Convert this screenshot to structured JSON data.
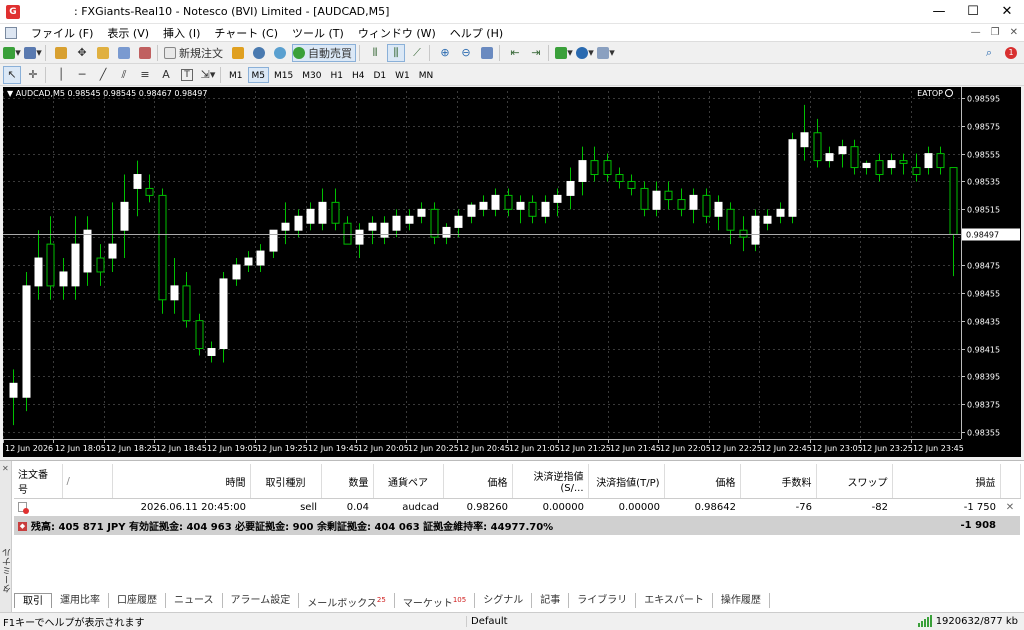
{
  "window": {
    "title": ": FXGiants-Real10 - Notesco (BVI) Limited - [AUDCAD,M5]",
    "app_icon": "G",
    "minimize": "—",
    "maximize": "☐",
    "close": "✕"
  },
  "menu": [
    "ファイル (F)",
    "表示 (V)",
    "挿入 (I)",
    "チャート (C)",
    "ツール (T)",
    "ウィンドウ (W)",
    "ヘルプ (H)"
  ],
  "toolbar": {
    "new_order": "新規注文",
    "auto_trading": "自動売買",
    "timeframes": [
      "M1",
      "M5",
      "M15",
      "M30",
      "H1",
      "H4",
      "D1",
      "W1",
      "MN"
    ],
    "selected_timeframe": "M5",
    "text_tool": "A",
    "text_label_tool": "T"
  },
  "chart": {
    "header": "AUDCAD,M5  0.98545 0.98545 0.98467 0.98497",
    "ea_label": "EATOP",
    "current_price": "0.98497",
    "colors": {
      "background": "#000000",
      "grid": "#3a3a3a",
      "bull_body": "#ffffff",
      "wick": "#00c000",
      "text": "#ffffff"
    },
    "price_labels": [
      "0.98595",
      "0.98575",
      "0.98555",
      "0.98535",
      "0.98515",
      "0.98495",
      "0.98475",
      "0.98455",
      "0.98435",
      "0.98415",
      "0.98395",
      "0.98375",
      "0.98355"
    ],
    "time_labels": [
      "12 Jun 2026",
      "12 Jun 18:05",
      "12 Jun 18:25",
      "12 Jun 18:45",
      "12 Jun 19:05",
      "12 Jun 19:25",
      "12 Jun 19:45",
      "12 Jun 20:05",
      "12 Jun 20:25",
      "12 Jun 20:45",
      "12 Jun 21:05",
      "12 Jun 21:25",
      "12 Jun 21:45",
      "12 Jun 22:05",
      "12 Jun 22:25",
      "12 Jun 22:45",
      "12 Jun 23:05",
      "12 Jun 23:25",
      "12 Jun 23:45"
    ]
  },
  "chart_data": {
    "type": "candlestick",
    "symbol": "AUDCAD",
    "timeframe": "M5",
    "ylim": [
      0.9835,
      0.986
    ],
    "candles": [
      {
        "o": 0.9838,
        "h": 0.984,
        "l": 0.9836,
        "c": 0.9839
      },
      {
        "o": 0.9838,
        "h": 0.9847,
        "l": 0.9837,
        "c": 0.9846
      },
      {
        "o": 0.9846,
        "h": 0.985,
        "l": 0.9845,
        "c": 0.9848
      },
      {
        "o": 0.9849,
        "h": 0.9851,
        "l": 0.9845,
        "c": 0.9846
      },
      {
        "o": 0.9846,
        "h": 0.9848,
        "l": 0.9845,
        "c": 0.9847
      },
      {
        "o": 0.9846,
        "h": 0.9851,
        "l": 0.9845,
        "c": 0.9849
      },
      {
        "o": 0.9847,
        "h": 0.9851,
        "l": 0.9846,
        "c": 0.985
      },
      {
        "o": 0.9848,
        "h": 0.9849,
        "l": 0.9846,
        "c": 0.9847
      },
      {
        "o": 0.9848,
        "h": 0.9852,
        "l": 0.9847,
        "c": 0.9849
      },
      {
        "o": 0.985,
        "h": 0.9854,
        "l": 0.9848,
        "c": 0.9852
      },
      {
        "o": 0.9853,
        "h": 0.9855,
        "l": 0.9851,
        "c": 0.9854
      },
      {
        "o": 0.9853,
        "h": 0.9854,
        "l": 0.9852,
        "c": 0.98525
      },
      {
        "o": 0.98525,
        "h": 0.9853,
        "l": 0.9844,
        "c": 0.9845
      },
      {
        "o": 0.9845,
        "h": 0.9848,
        "l": 0.9844,
        "c": 0.9846
      },
      {
        "o": 0.9846,
        "h": 0.9847,
        "l": 0.9843,
        "c": 0.98435
      },
      {
        "o": 0.98435,
        "h": 0.9844,
        "l": 0.9841,
        "c": 0.98415
      },
      {
        "o": 0.9841,
        "h": 0.9842,
        "l": 0.98405,
        "c": 0.98415
      },
      {
        "o": 0.98415,
        "h": 0.9847,
        "l": 0.98405,
        "c": 0.98465
      },
      {
        "o": 0.98465,
        "h": 0.9848,
        "l": 0.9846,
        "c": 0.98475
      },
      {
        "o": 0.98475,
        "h": 0.98485,
        "l": 0.9847,
        "c": 0.9848
      },
      {
        "o": 0.98475,
        "h": 0.9849,
        "l": 0.9847,
        "c": 0.98485
      },
      {
        "o": 0.98485,
        "h": 0.985,
        "l": 0.9848,
        "c": 0.985
      },
      {
        "o": 0.985,
        "h": 0.9852,
        "l": 0.9849,
        "c": 0.98505
      },
      {
        "o": 0.985,
        "h": 0.98515,
        "l": 0.98495,
        "c": 0.9851
      },
      {
        "o": 0.98505,
        "h": 0.9852,
        "l": 0.985,
        "c": 0.98515
      },
      {
        "o": 0.98505,
        "h": 0.9853,
        "l": 0.985,
        "c": 0.9852
      },
      {
        "o": 0.9852,
        "h": 0.9853,
        "l": 0.985,
        "c": 0.98505
      },
      {
        "o": 0.98505,
        "h": 0.9851,
        "l": 0.9849,
        "c": 0.9849
      },
      {
        "o": 0.9849,
        "h": 0.98505,
        "l": 0.9848,
        "c": 0.985
      },
      {
        "o": 0.985,
        "h": 0.9851,
        "l": 0.9849,
        "c": 0.98505
      },
      {
        "o": 0.98495,
        "h": 0.9851,
        "l": 0.9849,
        "c": 0.98505
      },
      {
        "o": 0.985,
        "h": 0.98515,
        "l": 0.98495,
        "c": 0.9851
      },
      {
        "o": 0.98505,
        "h": 0.98515,
        "l": 0.985,
        "c": 0.9851
      },
      {
        "o": 0.9851,
        "h": 0.9852,
        "l": 0.98505,
        "c": 0.98515
      },
      {
        "o": 0.98515,
        "h": 0.9852,
        "l": 0.9849,
        "c": 0.98495
      },
      {
        "o": 0.98495,
        "h": 0.98505,
        "l": 0.9849,
        "c": 0.98502
      },
      {
        "o": 0.98502,
        "h": 0.98515,
        "l": 0.98495,
        "c": 0.9851
      },
      {
        "o": 0.9851,
        "h": 0.9852,
        "l": 0.98505,
        "c": 0.98518
      },
      {
        "o": 0.98515,
        "h": 0.98525,
        "l": 0.9851,
        "c": 0.9852
      },
      {
        "o": 0.98515,
        "h": 0.9853,
        "l": 0.9851,
        "c": 0.98525
      },
      {
        "o": 0.98525,
        "h": 0.9853,
        "l": 0.9851,
        "c": 0.98515
      },
      {
        "o": 0.98515,
        "h": 0.98525,
        "l": 0.98505,
        "c": 0.9852
      },
      {
        "o": 0.9852,
        "h": 0.98525,
        "l": 0.98505,
        "c": 0.9851
      },
      {
        "o": 0.9851,
        "h": 0.98525,
        "l": 0.98505,
        "c": 0.9852
      },
      {
        "o": 0.9852,
        "h": 0.9853,
        "l": 0.9851,
        "c": 0.98525
      },
      {
        "o": 0.98525,
        "h": 0.98545,
        "l": 0.98515,
        "c": 0.98535
      },
      {
        "o": 0.98535,
        "h": 0.9856,
        "l": 0.98525,
        "c": 0.9855
      },
      {
        "o": 0.9855,
        "h": 0.9856,
        "l": 0.98535,
        "c": 0.9854
      },
      {
        "o": 0.9855,
        "h": 0.98555,
        "l": 0.98535,
        "c": 0.9854
      },
      {
        "o": 0.9854,
        "h": 0.98545,
        "l": 0.9853,
        "c": 0.98535
      },
      {
        "o": 0.98535,
        "h": 0.9854,
        "l": 0.98525,
        "c": 0.9853
      },
      {
        "o": 0.9853,
        "h": 0.98535,
        "l": 0.9851,
        "c": 0.98515
      },
      {
        "o": 0.98515,
        "h": 0.98535,
        "l": 0.9851,
        "c": 0.98528
      },
      {
        "o": 0.98528,
        "h": 0.98535,
        "l": 0.98515,
        "c": 0.98522
      },
      {
        "o": 0.98522,
        "h": 0.9853,
        "l": 0.9851,
        "c": 0.98515
      },
      {
        "o": 0.98515,
        "h": 0.9853,
        "l": 0.98505,
        "c": 0.98525
      },
      {
        "o": 0.98525,
        "h": 0.9853,
        "l": 0.98505,
        "c": 0.9851
      },
      {
        "o": 0.9851,
        "h": 0.98525,
        "l": 0.985,
        "c": 0.9852
      },
      {
        "o": 0.98515,
        "h": 0.9852,
        "l": 0.9849,
        "c": 0.985
      },
      {
        "o": 0.985,
        "h": 0.9851,
        "l": 0.98485,
        "c": 0.98495
      },
      {
        "o": 0.9849,
        "h": 0.98515,
        "l": 0.98485,
        "c": 0.9851
      },
      {
        "o": 0.98505,
        "h": 0.98515,
        "l": 0.985,
        "c": 0.9851
      },
      {
        "o": 0.9851,
        "h": 0.9852,
        "l": 0.98505,
        "c": 0.98515
      },
      {
        "o": 0.9851,
        "h": 0.9857,
        "l": 0.98505,
        "c": 0.98565
      },
      {
        "o": 0.9856,
        "h": 0.9859,
        "l": 0.9855,
        "c": 0.9857
      },
      {
        "o": 0.9857,
        "h": 0.9858,
        "l": 0.98545,
        "c": 0.9855
      },
      {
        "o": 0.9855,
        "h": 0.9856,
        "l": 0.98545,
        "c": 0.98555
      },
      {
        "o": 0.98555,
        "h": 0.98565,
        "l": 0.98545,
        "c": 0.9856
      },
      {
        "o": 0.9856,
        "h": 0.98565,
        "l": 0.9854,
        "c": 0.98545
      },
      {
        "o": 0.98545,
        "h": 0.9855,
        "l": 0.9854,
        "c": 0.98548
      },
      {
        "o": 0.9855,
        "h": 0.98555,
        "l": 0.98535,
        "c": 0.9854
      },
      {
        "o": 0.98545,
        "h": 0.98555,
        "l": 0.9854,
        "c": 0.9855
      },
      {
        "o": 0.9855,
        "h": 0.98555,
        "l": 0.9854,
        "c": 0.98548
      },
      {
        "o": 0.98545,
        "h": 0.98555,
        "l": 0.98535,
        "c": 0.9854
      },
      {
        "o": 0.98545,
        "h": 0.9856,
        "l": 0.9854,
        "c": 0.98555
      },
      {
        "o": 0.98555,
        "h": 0.9856,
        "l": 0.9854,
        "c": 0.98545
      },
      {
        "o": 0.98545,
        "h": 0.98545,
        "l": 0.98467,
        "c": 0.98497
      }
    ]
  },
  "terminal": {
    "side_label": "ターミナル",
    "close": "✕",
    "columns": [
      "注文番号",
      "/",
      "時間",
      "取引種別",
      "数量",
      "通貨ペア",
      "価格",
      "決済逆指値(S/...",
      "決済指値(T/P)",
      "価格",
      "手数料",
      "スワップ",
      "損益"
    ],
    "order": {
      "id": "",
      "time": "2026.06.11 20:45:00",
      "type": "sell",
      "volume": "0.04",
      "symbol": "audcad",
      "open_price": "0.98260",
      "sl": "0.00000",
      "tp": "0.00000",
      "price": "0.98642",
      "commission": "-76",
      "swap": "-82",
      "profit": "-1 750",
      "close": "✕"
    },
    "summary": {
      "text": "残高: 405 871 JPY  有効証拠金: 404 963  必要証拠金: 900  余剰証拠金: 404 063  証拠金維持率: 44977.70%",
      "total": "-1 908"
    },
    "tabs": [
      {
        "label": "取引",
        "badge": ""
      },
      {
        "label": "運用比率",
        "badge": ""
      },
      {
        "label": "口座履歴",
        "badge": ""
      },
      {
        "label": "ニュース",
        "badge": ""
      },
      {
        "label": "アラーム設定",
        "badge": ""
      },
      {
        "label": "メールボックス",
        "badge": "25"
      },
      {
        "label": "マーケット",
        "badge": "105"
      },
      {
        "label": "シグナル",
        "badge": ""
      },
      {
        "label": "記事",
        "badge": ""
      },
      {
        "label": "ライブラリ",
        "badge": ""
      },
      {
        "label": "エキスパート",
        "badge": ""
      },
      {
        "label": "操作履歴",
        "badge": ""
      }
    ]
  },
  "status": {
    "help": "F1キーでヘルプが表示されます",
    "profile": "Default",
    "connection": "1920632/877 kb"
  }
}
